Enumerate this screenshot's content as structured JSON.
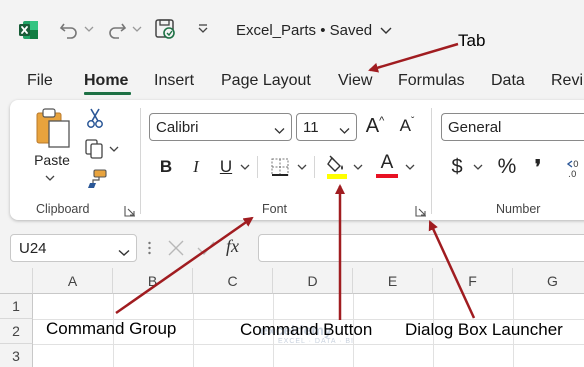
{
  "titlebar": {
    "app_icon": "excel-logo-icon",
    "undo_icon": "undo-icon",
    "redo_icon": "redo-icon",
    "autosave_icon": "autosave-icon",
    "customize_icon": "customize-qat-icon",
    "document_title": "Excel_Parts • Saved",
    "colors": {
      "brand": "#1e7145"
    }
  },
  "tabs": [
    {
      "label": "File",
      "active": false
    },
    {
      "label": "Home",
      "active": true
    },
    {
      "label": "Insert",
      "active": false
    },
    {
      "label": "Page Layout",
      "active": false
    },
    {
      "label": "View",
      "active": false
    },
    {
      "label": "Formulas",
      "active": false
    },
    {
      "label": "Data",
      "active": false
    },
    {
      "label": "Revi",
      "active": false
    }
  ],
  "ribbon": {
    "clipboard": {
      "paste_label": "Paste",
      "group_label": "Clipboard",
      "icons": [
        "paste-icon",
        "cut-icon",
        "copy-icon",
        "format-painter-icon"
      ]
    },
    "font": {
      "font_name": "Calibri",
      "font_size": "11",
      "bold": "B",
      "italic": "I",
      "underline": "U",
      "font_color_letter": "A",
      "grow_letter": "A",
      "shrink_letter": "A",
      "group_label": "Font",
      "colors": {
        "highlight": "#ffff00",
        "font_color": "#e81123"
      }
    },
    "number": {
      "format": "General",
      "currency": "$",
      "percent": "%",
      "comma": "❜",
      "group_label": "Number"
    }
  },
  "formula_bar": {
    "name_box": "U24",
    "fx": "fx",
    "value": ""
  },
  "grid": {
    "columns": [
      "A",
      "B",
      "C",
      "D",
      "E",
      "F",
      "G"
    ],
    "rows": [
      "1",
      "2",
      "3"
    ]
  },
  "annotations": {
    "tab": "Tab",
    "command_group": "Command Group",
    "command_button": "Command Button",
    "dialog_box_launcher": "Dialog Box Launcher",
    "color": "#a01c20"
  },
  "watermark": {
    "name": "exceldemy",
    "tagline": "EXCEL · DATA · BI"
  }
}
